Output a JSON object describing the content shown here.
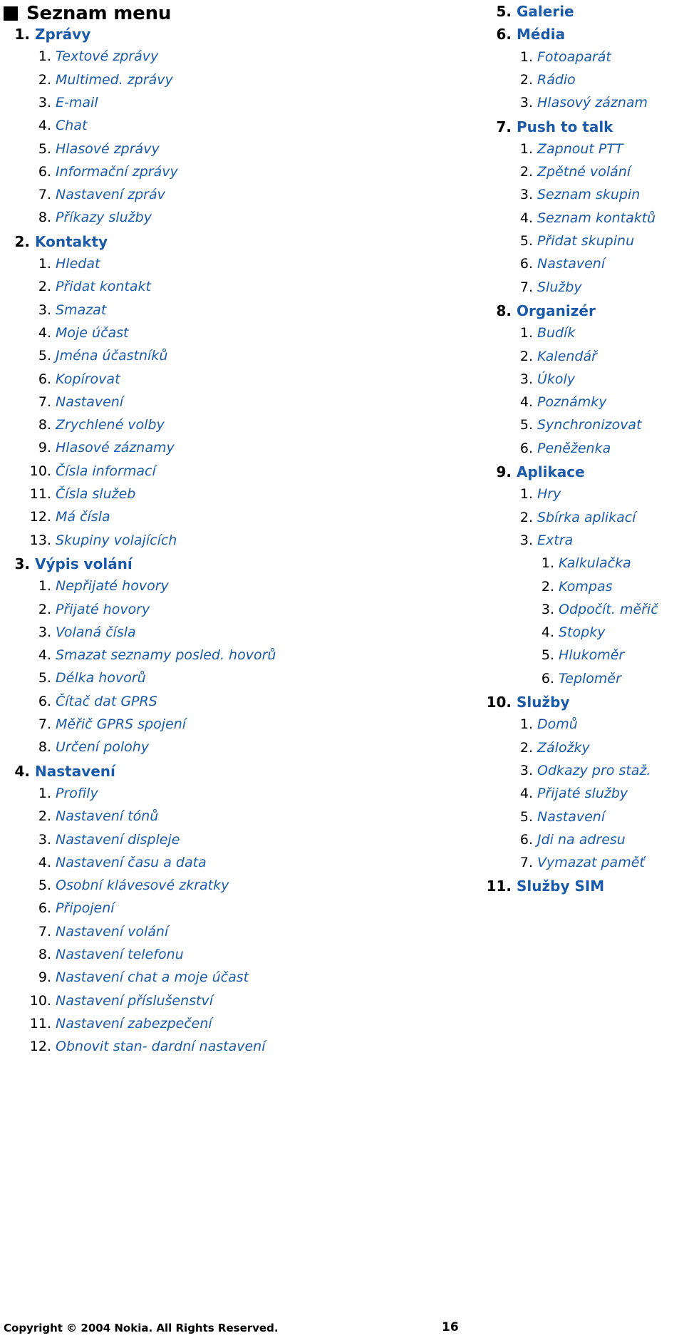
{
  "heading": {
    "bullet_icon": "filled-square-bullet",
    "title": "Seznam menu"
  },
  "colors": {
    "link_blue": "#1a5aa8",
    "number_black": "#000000",
    "page_background": "#ffffff"
  },
  "left_column": [
    {
      "level": 1,
      "num": "1.",
      "label": "Zprávy"
    },
    {
      "level": 2,
      "num": "1.",
      "label": "Textové zprávy"
    },
    {
      "level": 2,
      "num": "2.",
      "label": "Multimed. zprávy"
    },
    {
      "level": 2,
      "num": "3.",
      "label": "E-mail"
    },
    {
      "level": 2,
      "num": "4.",
      "label": "Chat"
    },
    {
      "level": 2,
      "num": "5.",
      "label": "Hlasové zprávy"
    },
    {
      "level": 2,
      "num": "6.",
      "label": "Informační zprávy"
    },
    {
      "level": 2,
      "num": "7.",
      "label": "Nastavení zpráv"
    },
    {
      "level": 2,
      "num": "8.",
      "label": "Příkazy služby"
    },
    {
      "level": 1,
      "num": "2.",
      "label": "Kontakty"
    },
    {
      "level": 2,
      "num": "1.",
      "label": "Hledat"
    },
    {
      "level": 2,
      "num": "2.",
      "label": "Přidat kontakt"
    },
    {
      "level": 2,
      "num": "3.",
      "label": "Smazat"
    },
    {
      "level": 2,
      "num": "4.",
      "label": "Moje účast"
    },
    {
      "level": 2,
      "num": "5.",
      "label": "Jména účastníků"
    },
    {
      "level": 2,
      "num": "6.",
      "label": "Kopírovat"
    },
    {
      "level": 2,
      "num": "7.",
      "label": "Nastavení"
    },
    {
      "level": 2,
      "num": "8.",
      "label": "Zrychlené volby"
    },
    {
      "level": 2,
      "num": "9.",
      "label": "Hlasové záznamy"
    },
    {
      "level": 2,
      "num": "10.",
      "label": "Čísla informací"
    },
    {
      "level": 2,
      "num": "11.",
      "label": "Čísla služeb"
    },
    {
      "level": 2,
      "num": "12.",
      "label": "Má čísla"
    },
    {
      "level": 2,
      "num": "13.",
      "label": "Skupiny volajících"
    },
    {
      "level": 1,
      "num": "3.",
      "label": "Výpis volání"
    },
    {
      "level": 2,
      "num": "1.",
      "label": "Nepřijaté hovory"
    },
    {
      "level": 2,
      "num": "2.",
      "label": "Přijaté hovory"
    },
    {
      "level": 2,
      "num": "3.",
      "label": "Volaná čísla"
    },
    {
      "level": 2,
      "num": "4.",
      "label": "Smazat seznamy posled. hovorů"
    },
    {
      "level": 2,
      "num": "5.",
      "label": "Délka hovorů"
    },
    {
      "level": 2,
      "num": "6.",
      "label": "Čítač dat GPRS"
    },
    {
      "level": 2,
      "num": "7.",
      "label": "Měřič GPRS spojení"
    },
    {
      "level": 2,
      "num": "8.",
      "label": "Určení polohy"
    },
    {
      "level": 1,
      "num": "4.",
      "label": "Nastavení"
    },
    {
      "level": 2,
      "num": "1.",
      "label": "Profily"
    },
    {
      "level": 2,
      "num": "2.",
      "label": "Nastavení tónů"
    },
    {
      "level": 2,
      "num": "3.",
      "label": "Nastavení displeje"
    },
    {
      "level": 2,
      "num": "4.",
      "label": "Nastavení času a data"
    },
    {
      "level": 2,
      "num": "5.",
      "label": "Osobní klávesové zkratky"
    },
    {
      "level": 2,
      "num": "6.",
      "label": "Připojení"
    },
    {
      "level": 2,
      "num": "7.",
      "label": "Nastavení volání"
    },
    {
      "level": 2,
      "num": "8.",
      "label": "Nastavení telefonu"
    },
    {
      "level": 2,
      "num": "9.",
      "label": "Nastavení chat a moje účast"
    },
    {
      "level": 2,
      "num": "10.",
      "label": "Nastavení příslušenství"
    },
    {
      "level": 2,
      "num": "11.",
      "label": "Nastavení zabezpečení"
    },
    {
      "level": 2,
      "num": "12.",
      "label": "Obnovit stan- dardní nastavení"
    }
  ],
  "right_column": [
    {
      "level": 1,
      "num": "5.",
      "label": "Galerie"
    },
    {
      "level": 1,
      "num": "6.",
      "label": "Média"
    },
    {
      "level": 2,
      "num": "1.",
      "label": "Fotoaparát"
    },
    {
      "level": 2,
      "num": "2.",
      "label": "Rádio"
    },
    {
      "level": 2,
      "num": "3.",
      "label": "Hlasový záznam"
    },
    {
      "level": 1,
      "num": "7.",
      "label": "Push to talk"
    },
    {
      "level": 2,
      "num": "1.",
      "label": "Zapnout PTT"
    },
    {
      "level": 2,
      "num": "2.",
      "label": "Zpětné volání"
    },
    {
      "level": 2,
      "num": "3.",
      "label": "Seznam skupin"
    },
    {
      "level": 2,
      "num": "4.",
      "label": "Seznam kontaktů"
    },
    {
      "level": 2,
      "num": "5.",
      "label": "Přidat skupinu"
    },
    {
      "level": 2,
      "num": "6.",
      "label": "Nastavení"
    },
    {
      "level": 2,
      "num": "7.",
      "label": "Služby"
    },
    {
      "level": 1,
      "num": "8.",
      "label": "Organizér"
    },
    {
      "level": 2,
      "num": "1.",
      "label": "Budík"
    },
    {
      "level": 2,
      "num": "2.",
      "label": "Kalendář"
    },
    {
      "level": 2,
      "num": "3.",
      "label": "Úkoly"
    },
    {
      "level": 2,
      "num": "4.",
      "label": "Poznámky"
    },
    {
      "level": 2,
      "num": "5.",
      "label": "Synchronizovat"
    },
    {
      "level": 2,
      "num": "6.",
      "label": "Peněženka"
    },
    {
      "level": 1,
      "num": "9.",
      "label": "Aplikace"
    },
    {
      "level": 2,
      "num": "1.",
      "label": "Hry"
    },
    {
      "level": 2,
      "num": "2.",
      "label": "Sbírka aplikací"
    },
    {
      "level": 2,
      "num": "3.",
      "label": "Extra"
    },
    {
      "level": 3,
      "num": "1.",
      "label": "Kalkulačka"
    },
    {
      "level": 3,
      "num": "2.",
      "label": "Kompas"
    },
    {
      "level": 3,
      "num": "3.",
      "label": "Odpočít. měřič"
    },
    {
      "level": 3,
      "num": "4.",
      "label": "Stopky"
    },
    {
      "level": 3,
      "num": "5.",
      "label": "Hlukoměr"
    },
    {
      "level": 3,
      "num": "6.",
      "label": "Teploměr"
    },
    {
      "level": 1,
      "num": "10.",
      "label": "Služby"
    },
    {
      "level": 2,
      "num": "1.",
      "label": "Domů"
    },
    {
      "level": 2,
      "num": "2.",
      "label": "Záložky"
    },
    {
      "level": 2,
      "num": "3.",
      "label": "Odkazy pro staž."
    },
    {
      "level": 2,
      "num": "4.",
      "label": "Přijaté služby"
    },
    {
      "level": 2,
      "num": "5.",
      "label": "Nastavení"
    },
    {
      "level": 2,
      "num": "6.",
      "label": "Jdi na adresu"
    },
    {
      "level": 2,
      "num": "7.",
      "label": "Vymazat paměť"
    },
    {
      "level": 1,
      "num": "11.",
      "label": "Služby SIM"
    }
  ],
  "footer": {
    "copyright": "Copyright © 2004 Nokia. All Rights Reserved.",
    "page_number": "16"
  }
}
